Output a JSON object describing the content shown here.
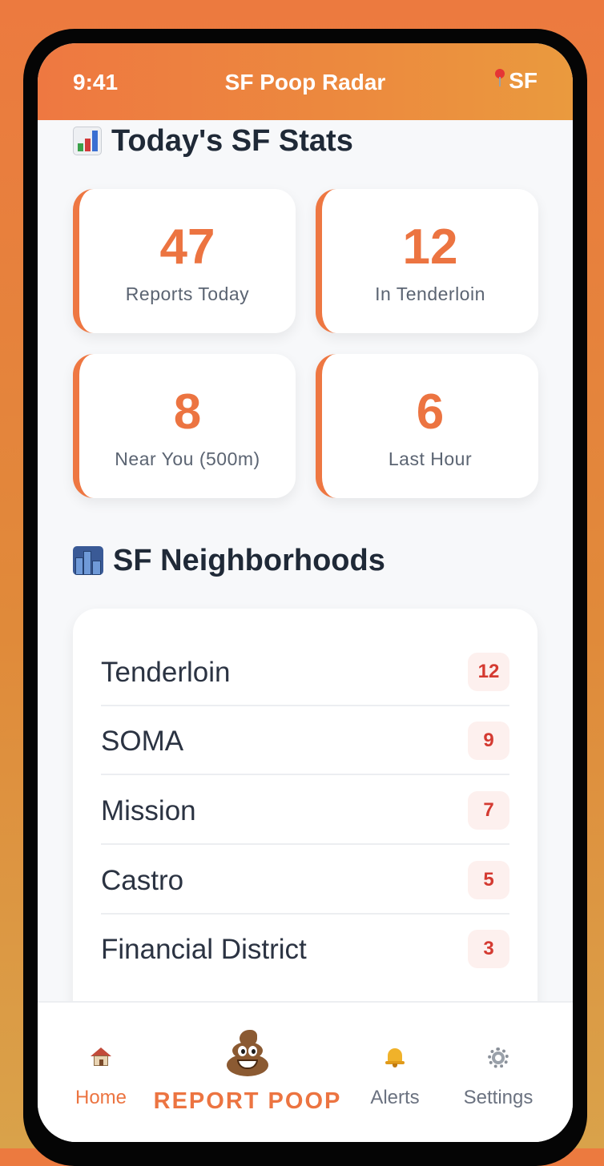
{
  "status_bar": {
    "time": "9:41",
    "app_title": "SF Poop Radar",
    "location": "SF"
  },
  "stats_section": {
    "title": "Today's SF Stats",
    "cards": [
      {
        "value": "47",
        "label": "Reports Today"
      },
      {
        "value": "12",
        "label": "In Tenderloin"
      },
      {
        "value": "8",
        "label": "Near You (500m)"
      },
      {
        "value": "6",
        "label": "Last Hour"
      }
    ]
  },
  "neighborhoods_section": {
    "title": "SF Neighborhoods",
    "items": [
      {
        "name": "Tenderloin",
        "count": "12"
      },
      {
        "name": "SOMA",
        "count": "9"
      },
      {
        "name": "Mission",
        "count": "7"
      },
      {
        "name": "Castro",
        "count": "5"
      },
      {
        "name": "Financial District",
        "count": "3"
      }
    ]
  },
  "bottom_nav": {
    "home": "Home",
    "report": "REPORT POOP",
    "alerts": "Alerts",
    "settings": "Settings"
  },
  "colors": {
    "accent": "#ec7441",
    "badge_text": "#d43a31",
    "badge_bg": "#fdf0ee",
    "background": "#f7f8fa"
  },
  "icons": {
    "location": "pin-icon",
    "stats": "chart-icon",
    "neighborhoods": "city-icon",
    "home": "house-icon",
    "report": "poop-icon",
    "alerts": "bell-icon",
    "settings": "gear-icon"
  }
}
